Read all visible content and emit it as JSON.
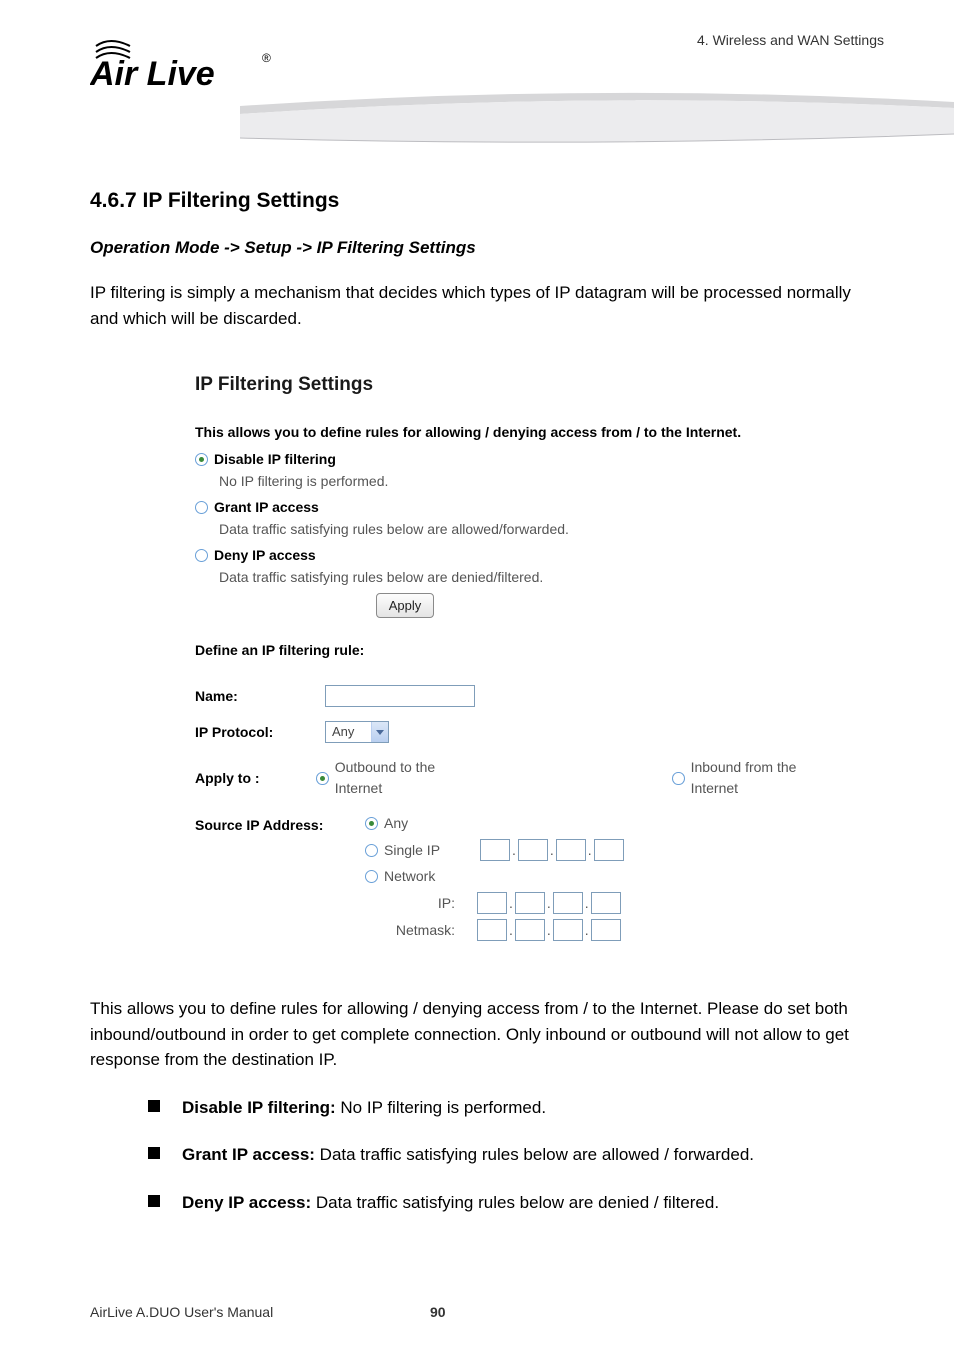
{
  "header": {
    "chapter": "4. Wireless and WAN Settings",
    "logo_text": "Air Live",
    "logo_r": "®"
  },
  "section": {
    "heading": "4.6.7 IP Filtering Settings",
    "breadcrumb": "Operation Mode -> Setup -> IP Filtering Settings",
    "intro": "IP filtering is simply a mechanism that decides which types of IP datagram will be processed normally and which will be discarded."
  },
  "ui": {
    "title": "IP Filtering Settings",
    "intro": "This allows you to define rules for allowing / denying access from / to the Internet.",
    "opts": [
      {
        "label": "Disable IP filtering",
        "desc": "No IP filtering is performed.",
        "checked": true
      },
      {
        "label": "Grant IP access",
        "desc": "Data traffic satisfying rules below are allowed/forwarded.",
        "checked": false
      },
      {
        "label": "Deny IP access",
        "desc": "Data traffic satisfying rules below are denied/filtered.",
        "checked": false
      }
    ],
    "apply": "Apply",
    "define_label": "Define an IP filtering rule:",
    "name_label": "Name:",
    "protocol_label": "IP Protocol:",
    "protocol_value": "Any",
    "applyto_label": "Apply to :",
    "applyto_out": "Outbound to the Internet",
    "applyto_in": "Inbound from the Internet",
    "src_label": "Source IP Address:",
    "src_any": "Any",
    "src_single": "Single IP",
    "src_network": "Network",
    "src_ip": "IP:",
    "src_netmask": "Netmask:"
  },
  "post": {
    "para": "This allows you to define rules for allowing / denying access from / to the Internet. Please do set both inbound/outbound in order to get complete connection. Only inbound or outbound will not allow to get response from the destination IP.",
    "bullets": [
      {
        "bold": "Disable IP filtering:",
        "rest": " No IP filtering is performed."
      },
      {
        "bold": "Grant IP access:",
        "rest": " Data traffic satisfying rules below are allowed / forwarded."
      },
      {
        "bold": "Deny IP access:",
        "rest": " Data traffic satisfying rules below are denied / filtered."
      }
    ]
  },
  "footer": {
    "manual": "AirLive A.DUO User's Manual",
    "page": "90"
  }
}
